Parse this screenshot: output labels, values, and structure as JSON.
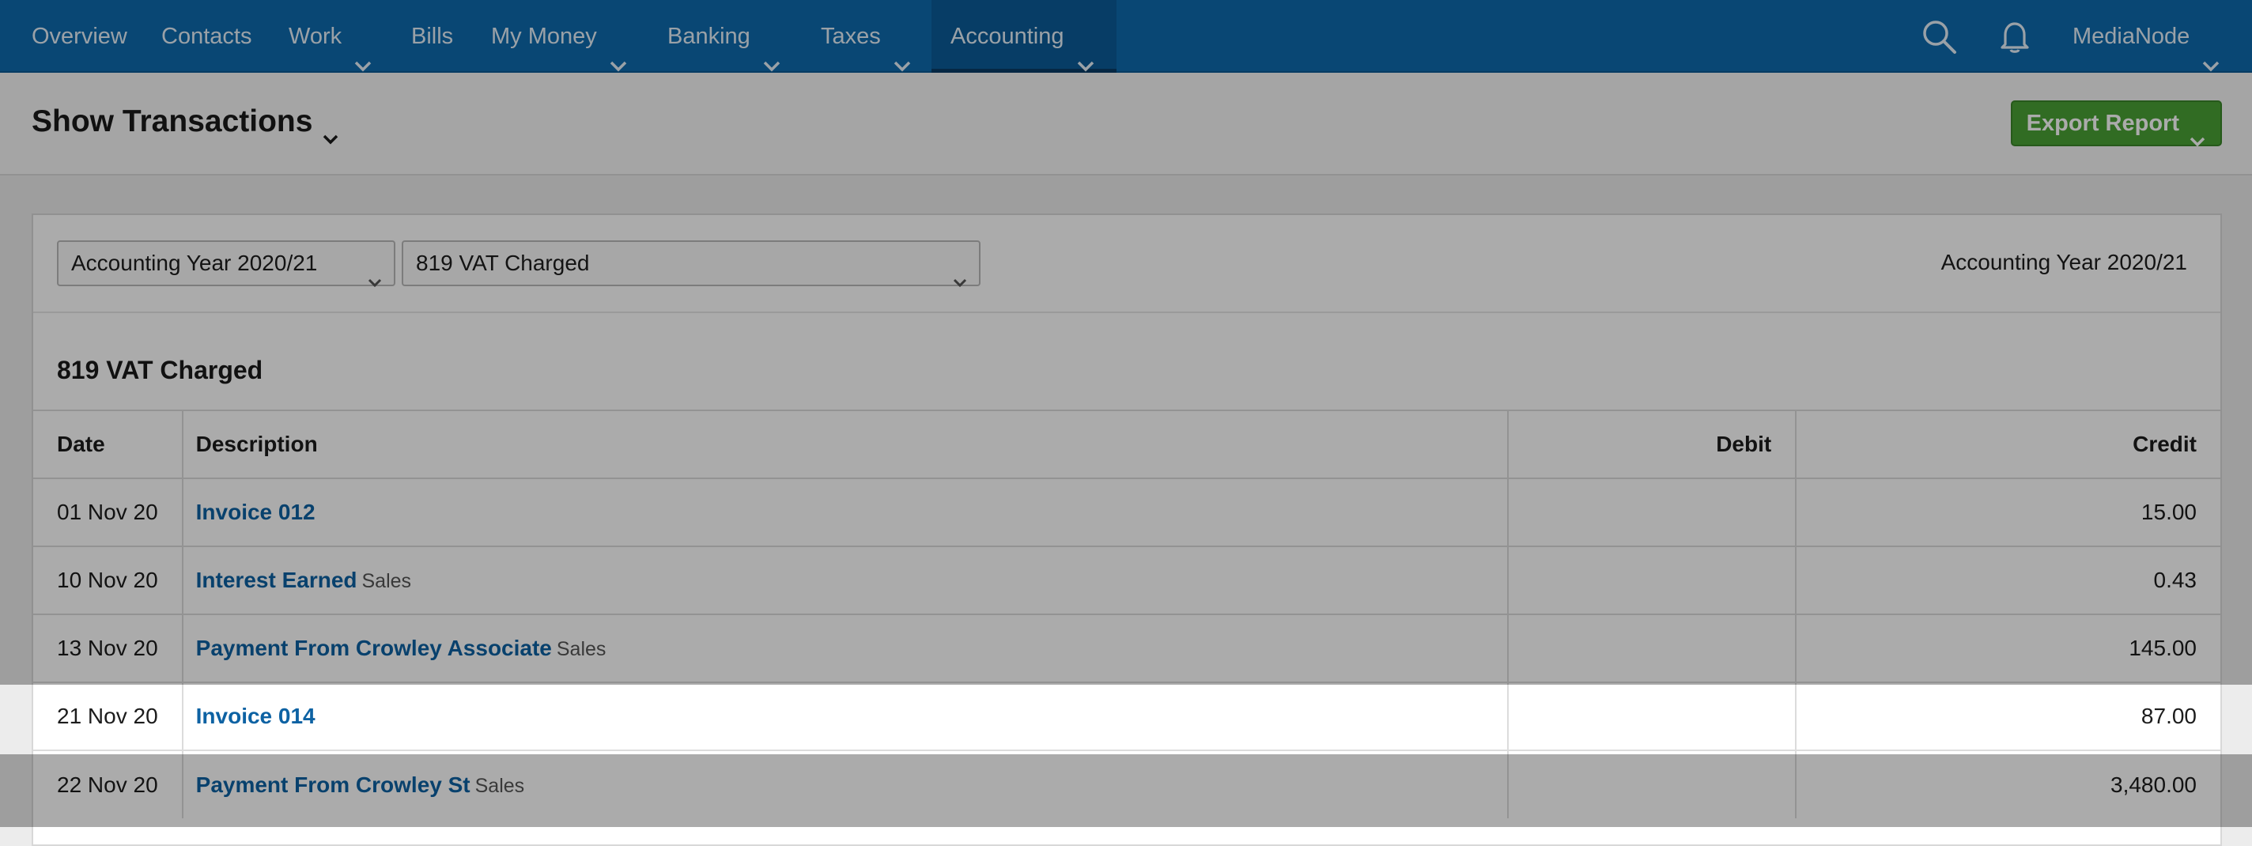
{
  "nav": {
    "items": [
      {
        "label": "Overview",
        "has_dropdown": false,
        "active": false
      },
      {
        "label": "Contacts",
        "has_dropdown": false,
        "active": false
      },
      {
        "label": "Work",
        "has_dropdown": true,
        "active": false
      },
      {
        "label": "Bills",
        "has_dropdown": false,
        "active": false
      },
      {
        "label": "My Money",
        "has_dropdown": true,
        "active": false
      },
      {
        "label": "Banking",
        "has_dropdown": true,
        "active": false
      },
      {
        "label": "Taxes",
        "has_dropdown": true,
        "active": false
      },
      {
        "label": "Accounting",
        "has_dropdown": true,
        "active": true
      }
    ],
    "account_label": "MediaNode",
    "icons": [
      "search-icon",
      "bell-icon"
    ]
  },
  "page": {
    "title": "Show Transactions",
    "export_label": "Export Report"
  },
  "filters": {
    "year_select": "Accounting Year 2020/21",
    "account_select": "819 VAT Charged",
    "period_label": "Accounting Year 2020/21"
  },
  "section_title": "819 VAT Charged",
  "table": {
    "headers": {
      "date": "Date",
      "description": "Description",
      "debit": "Debit",
      "credit": "Credit"
    },
    "rows": [
      {
        "date": "01 Nov 20",
        "description": "Invoice 012",
        "category": "",
        "debit": "",
        "credit": "15.00",
        "highlighted": false
      },
      {
        "date": "10 Nov 20",
        "description": "Interest Earned",
        "category": "Sales",
        "debit": "",
        "credit": "0.43",
        "highlighted": false
      },
      {
        "date": "13 Nov 20",
        "description": "Payment From Crowley Associate",
        "category": "Sales",
        "debit": "",
        "credit": "145.00",
        "highlighted": false
      },
      {
        "date": "21 Nov 20",
        "description": "Invoice 014",
        "category": "",
        "debit": "",
        "credit": "87.00",
        "highlighted": true
      },
      {
        "date": "22 Nov 20",
        "description": "Payment From Crowley St",
        "category": "Sales",
        "debit": "",
        "credit": "3,480.00",
        "highlighted": false
      }
    ]
  },
  "colors": {
    "nav_bg": "#0e6aae",
    "link": "#0d62a3",
    "export_button": "#49a135"
  }
}
